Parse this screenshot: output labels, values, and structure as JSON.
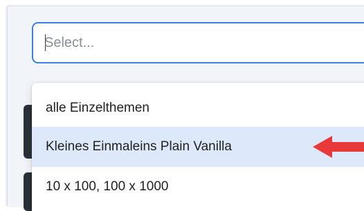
{
  "select": {
    "placeholder": "Select...",
    "value": ""
  },
  "menu": {
    "options": [
      {
        "label": "alle Einzelthemen",
        "highlighted": false
      },
      {
        "label": "Kleines Einmaleins Plain Vanilla",
        "highlighted": true
      },
      {
        "label": "10 x 100, 100 x 1000",
        "highlighted": false
      }
    ]
  },
  "colors": {
    "focus_border": "#3d7fe0",
    "highlight": "#dde9fa",
    "arrow": "#e8393a"
  }
}
